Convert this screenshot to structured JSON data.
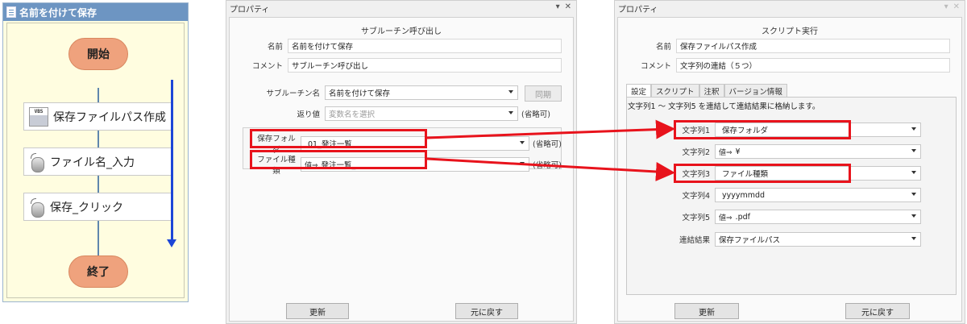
{
  "flow": {
    "title": "名前を付けて保存",
    "start": "開始",
    "end": "終了",
    "steps": [
      {
        "label": "保存ファイルパス作成",
        "icon": "vbs-script-icon",
        "icon_text": "VBS"
      },
      {
        "label": "ファイル名_入力",
        "icon": "mouse-icon"
      },
      {
        "label": "保存_クリック",
        "icon": "mouse-icon"
      }
    ]
  },
  "panel1": {
    "title": "プロパティ",
    "header": "サブルーチン呼び出し",
    "name_label": "名前",
    "name_value": "名前を付けて保存",
    "comment_label": "コメント",
    "comment_value": "サブルーチン呼び出し",
    "subroutine_label": "サブルーチン名",
    "subroutine_value": "名前を付けて保存",
    "sync_button": "同期",
    "return_label": "返り値",
    "return_placeholder": "変数名を選択",
    "optional": "(省略可)",
    "params": [
      {
        "label": "保存フォルダ",
        "prefix": "",
        "value": "01_発注一覧",
        "optional": "(省略可)"
      },
      {
        "label": "ファイル種類",
        "prefix": "値⇒",
        "value": "発注一覧_",
        "optional": "(省略可)"
      }
    ],
    "update_button": "更新",
    "revert_button": "元に戻す"
  },
  "panel2": {
    "title": "プロパティ",
    "header": "スクリプト実行",
    "name_label": "名前",
    "name_value": "保存ファイルパス作成",
    "comment_label": "コメント",
    "comment_value": "文字列の連結（５つ）",
    "tabs": [
      "設定",
      "スクリプト",
      "注釈",
      "バージョン情報"
    ],
    "description": "文字列1 ～ 文字列5 を連結して連結結果に格納します。",
    "strings": [
      {
        "label": "文字列1",
        "prefix": "",
        "value": "保存フォルダ"
      },
      {
        "label": "文字列2",
        "prefix": "値⇒",
        "value": "¥"
      },
      {
        "label": "文字列3",
        "prefix": "",
        "value": "ファイル種類"
      },
      {
        "label": "文字列4",
        "prefix": "",
        "value": "yyyymmdd"
      },
      {
        "label": "文字列5",
        "prefix": "値⇒",
        "value": ".pdf"
      }
    ],
    "result_label": "連結結果",
    "result_value": "保存ファイルパス",
    "update_button": "更新",
    "revert_button": "元に戻す"
  },
  "colors": {
    "highlight": "#e8131c",
    "flow_arrow": "#1d46d6",
    "terminal": "#efa27d",
    "flow_title": "#6d95c2"
  }
}
